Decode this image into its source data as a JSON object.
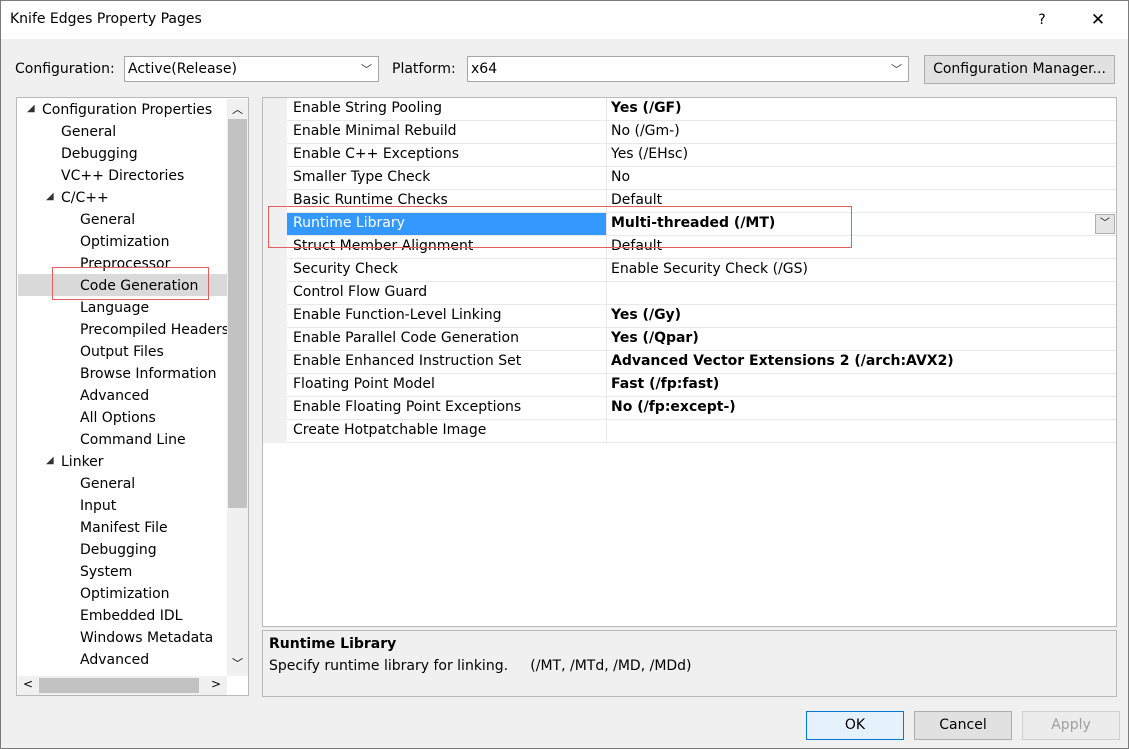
{
  "window": {
    "title": "Knife Edges Property Pages",
    "help": "?",
    "close": "✕"
  },
  "config": {
    "label": "Configuration:",
    "value": "Active(Release)",
    "platform_label": "Platform:",
    "platform_value": "x64",
    "manager_button": "Configuration Manager..."
  },
  "tree": {
    "items": [
      {
        "label": "Configuration Properties",
        "level": 0,
        "expand": "◢"
      },
      {
        "label": "General",
        "level": 1
      },
      {
        "label": "Debugging",
        "level": 1
      },
      {
        "label": "VC++ Directories",
        "level": 1
      },
      {
        "label": "C/C++",
        "level": 1,
        "expand": "◢"
      },
      {
        "label": "General",
        "level": 2
      },
      {
        "label": "Optimization",
        "level": 2
      },
      {
        "label": "Preprocessor",
        "level": 2
      },
      {
        "label": "Code Generation",
        "level": 2,
        "selected": true
      },
      {
        "label": "Language",
        "level": 2
      },
      {
        "label": "Precompiled Headers",
        "level": 2
      },
      {
        "label": "Output Files",
        "level": 2
      },
      {
        "label": "Browse Information",
        "level": 2
      },
      {
        "label": "Advanced",
        "level": 2
      },
      {
        "label": "All Options",
        "level": 2
      },
      {
        "label": "Command Line",
        "level": 2
      },
      {
        "label": "Linker",
        "level": 1,
        "expand": "◢"
      },
      {
        "label": "General",
        "level": 2
      },
      {
        "label": "Input",
        "level": 2
      },
      {
        "label": "Manifest File",
        "level": 2
      },
      {
        "label": "Debugging",
        "level": 2
      },
      {
        "label": "System",
        "level": 2
      },
      {
        "label": "Optimization",
        "level": 2
      },
      {
        "label": "Embedded IDL",
        "level": 2
      },
      {
        "label": "Windows Metadata",
        "level": 2
      },
      {
        "label": "Advanced",
        "level": 2
      }
    ]
  },
  "properties": [
    {
      "name": "Enable String Pooling",
      "value": "Yes (/GF)",
      "bold": true
    },
    {
      "name": "Enable Minimal Rebuild",
      "value": "No (/Gm-)",
      "bold": false
    },
    {
      "name": "Enable C++ Exceptions",
      "value": "Yes (/EHsc)",
      "bold": false
    },
    {
      "name": "Smaller Type Check",
      "value": "No",
      "bold": false
    },
    {
      "name": "Basic Runtime Checks",
      "value": "Default",
      "bold": false
    },
    {
      "name": "Runtime Library",
      "value": "Multi-threaded (/MT)",
      "bold": true,
      "selected": true
    },
    {
      "name": "Struct Member Alignment",
      "value": "Default",
      "bold": false
    },
    {
      "name": "Security Check",
      "value": "Enable Security Check (/GS)",
      "bold": false
    },
    {
      "name": "Control Flow Guard",
      "value": "",
      "bold": false
    },
    {
      "name": "Enable Function-Level Linking",
      "value": "Yes (/Gy)",
      "bold": true
    },
    {
      "name": "Enable Parallel Code Generation",
      "value": "Yes (/Qpar)",
      "bold": true
    },
    {
      "name": "Enable Enhanced Instruction Set",
      "value": "Advanced Vector Extensions 2 (/arch:AVX2)",
      "bold": true
    },
    {
      "name": "Floating Point Model",
      "value": "Fast (/fp:fast)",
      "bold": true
    },
    {
      "name": "Enable Floating Point Exceptions",
      "value": "No (/fp:except-)",
      "bold": true
    },
    {
      "name": "Create Hotpatchable Image",
      "value": "",
      "bold": false
    }
  ],
  "description": {
    "title": "Runtime Library",
    "text": "Specify runtime library for linking.     (/MT, /MTd, /MD, /MDd)"
  },
  "buttons": {
    "ok": "OK",
    "cancel": "Cancel",
    "apply": "Apply"
  }
}
